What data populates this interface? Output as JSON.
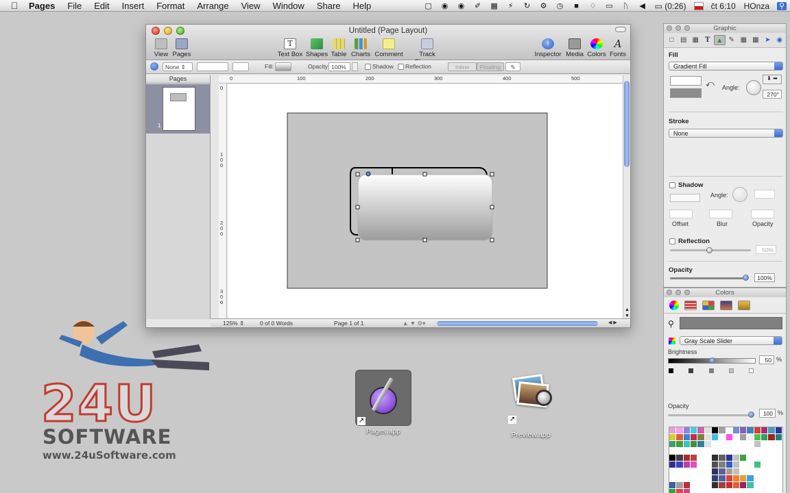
{
  "menubar": {
    "app": "Pages",
    "items": [
      "File",
      "Edit",
      "Insert",
      "Format",
      "Arrange",
      "View",
      "Window",
      "Share",
      "Help"
    ],
    "battery": "(0:26)",
    "clock": "čt 6:10",
    "user": "HOnza"
  },
  "window": {
    "title": "Untitled (Page Layout)",
    "toolbar": {
      "view": "View",
      "pages": "Pages",
      "textbox": "Text Box",
      "shapes": "Shapes",
      "table": "Table",
      "charts": "Charts",
      "comment": "Comment",
      "track": "Track Changes",
      "inspector": "Inspector",
      "media": "Media",
      "colors": "Colors",
      "fonts": "Fonts"
    },
    "format_bar": {
      "none": "None",
      "fill": "Fill:",
      "opacity_label": "Opacity:",
      "opacity_value": "100%",
      "shadow": "Shadow",
      "reflection": "Reflection",
      "inline": "Inline",
      "floating": "Floating"
    },
    "pages_header": "Pages",
    "thumb_number": "1",
    "ruler_h": [
      "0",
      "100",
      "200",
      "300",
      "400",
      "500"
    ],
    "ruler_v": [
      "0",
      "1 0 0",
      "2 0 0",
      "3 0 0"
    ],
    "status": {
      "zoom": "125%",
      "words": "0 of 0 Words",
      "page": "Page 1 of 1"
    }
  },
  "inspector": {
    "title": "Graphic",
    "fill_label": "Fill",
    "fill_type": "Gradient Fill",
    "angle_label": "Angle:",
    "angle_value": "270°",
    "stroke_label": "Stroke",
    "stroke_type": "None",
    "shadow_label": "Shadow",
    "shadow_angle_label": "Angle:",
    "offset_label": "Offset",
    "blur_label": "Blur",
    "shadow_opacity_label": "Opacity",
    "reflection_label": "Reflection",
    "reflection_value": "50%",
    "opacity_label": "Opacity",
    "opacity_value": "100%"
  },
  "colors": {
    "title": "Colors",
    "mode": "Gray Scale Slider",
    "brightness_label": "Brightness",
    "brightness_value": "50",
    "brightness_unit": "%",
    "brightness_level": 0.5,
    "opacity_label": "Opacity",
    "opacity_value": "100",
    "opacity_unit": "%",
    "swatches": [
      "#e8a0d8",
      "#f0a0f0",
      "#9080e0",
      "#40d0e0",
      "#d060b0",
      "#e0e0e0",
      "#000000",
      "#a0a0a0",
      "#ffffff",
      "#7090d0",
      "#8060c0",
      "#4080c0",
      "#d04040",
      "#a03070",
      "#40a0c0",
      "#303090",
      "#d0d030",
      "#e06030",
      "#4080d0",
      "#c03050",
      "#808040",
      "#e0e0e0",
      "#40c0e0",
      "#ffffff",
      "#ff50f0",
      "#ffffff",
      "#a0a0a0",
      "#f0f0f0",
      "#50c050",
      "#30a060",
      "#a02020",
      "#208080",
      "#40a070",
      "#40a040",
      "#40c0c0",
      "#409040",
      "#3080a0",
      "#e0e0e0",
      "#ffffff",
      "#ffffff",
      "#ffffff",
      "#ffffff",
      "#ffffff",
      "#ffffff",
      "#c0c0c0",
      "#ffffff",
      "#ffffff",
      "#ffffff",
      "#ffffff",
      "#ffffff",
      "#ffffff",
      "#ffffff",
      "#ffffff",
      "#ffffff",
      "#ffffff",
      "#ffffff",
      "#ffffff",
      "#ffffff",
      "#ffffff",
      "#ffffff",
      "#ffffff",
      "#ffffff",
      "#ffffff",
      "#ffffff",
      "#000000",
      "#404040",
      "#a03030",
      "#c04040",
      "#ffffff",
      "#ffffff",
      "#303030",
      "#606060",
      "#303090",
      "#c0c0c0",
      "#40a040",
      "#ffffff",
      "#ffffff",
      "#ffffff",
      "#ffffff",
      "#ffffff",
      "#303090",
      "#4040c0",
      "#c040a0",
      "#e050c0",
      "#ffffff",
      "#ffffff",
      "#505050",
      "#808080",
      "#3060c0",
      "#c0c0c0",
      "#ffffff",
      "#ffffff",
      "#40c080",
      "#ffffff",
      "#ffffff",
      "#ffffff",
      "#ffffff",
      "#ffffff",
      "#ffffff",
      "#ffffff",
      "#ffffff",
      "#ffffff",
      "#303060",
      "#606090",
      "#a0a0a0",
      "#c0c0c0",
      "#ffffff",
      "#ffffff",
      "#ffffff",
      "#ffffff",
      "#ffffff",
      "#ffffff",
      "#ffffff",
      "#ffffff",
      "#ffffff",
      "#ffffff",
      "#ffffff",
      "#ffffff",
      "#304070",
      "#5060a0",
      "#e04040",
      "#f08030",
      "#e0a030",
      "#40a0e0",
      "#ffffff",
      "#ffffff",
      "#ffffff",
      "#ffffff",
      "#4060a0",
      "#a0a0a0",
      "#c03030",
      "#ffffff",
      "#ffffff",
      "#ffffff",
      "#303030",
      "#a04040",
      "#c03030",
      "#e06030",
      "#a02060",
      "#40c0a0",
      "#ffffff",
      "#ffffff",
      "#ffffff",
      "#ffffff",
      "#30a040",
      "#e04050",
      "#d04090",
      "#ffffff",
      "#ffffff",
      "#ffffff",
      "#ffffff",
      "#ffffff",
      "#ffffff",
      "#ffffff",
      "#ffffff",
      "#ffffff",
      "#ffffff",
      "#ffffff",
      "#ffffff",
      "#ffffff"
    ]
  },
  "desktop": {
    "pages_icon": "Pages.app",
    "preview_icon": "Preview.app"
  },
  "logo": {
    "big": "24U",
    "software": "SOFTWARE",
    "url": "www.24uSoftware.com",
    "accent": "#c23a30"
  }
}
